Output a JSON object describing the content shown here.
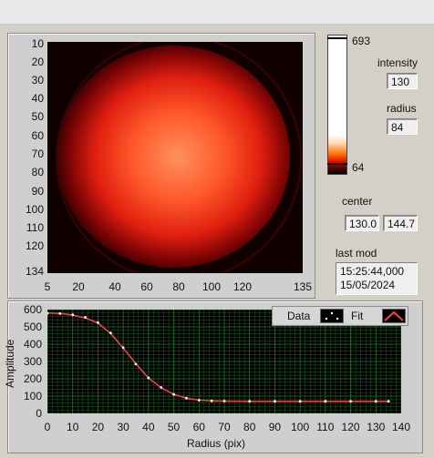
{
  "image": {
    "y_ticks": [
      "10",
      "20",
      "30",
      "40",
      "50",
      "60",
      "70",
      "80",
      "90",
      "100",
      "110",
      "120",
      "134"
    ],
    "x_ticks": [
      "5",
      "20",
      "40",
      "60",
      "80",
      "100",
      "120",
      "135"
    ]
  },
  "colorbar": {
    "max": "693",
    "min": "64"
  },
  "indicators": {
    "intensity_label": "intensity",
    "intensity_value": "130",
    "radius_label": "radius",
    "radius_value": "84",
    "center_label": "center",
    "center_x": "130.0",
    "center_y": "144.7",
    "lastmod_label": "last mod",
    "lastmod_time": "15:25:44,000",
    "lastmod_date": "15/05/2024"
  },
  "legend": {
    "data_label": "Data",
    "fit_label": "Fit"
  },
  "colors": {
    "data": "#ffffff",
    "fit": "#ff4040",
    "grid": "#1f7a2a",
    "plot_bg": "#000000"
  },
  "chart_data": {
    "type": "scatter",
    "xlabel": "Radius (pix)",
    "ylabel": "Amplitude",
    "xlim": [
      0,
      140
    ],
    "ylim": [
      0,
      600
    ],
    "x_ticks": [
      0,
      10,
      20,
      30,
      40,
      50,
      60,
      70,
      80,
      90,
      100,
      110,
      120,
      130,
      140
    ],
    "y_ticks": [
      0,
      100,
      200,
      300,
      400,
      500,
      600
    ],
    "series": [
      {
        "name": "Data",
        "x": [
          0,
          5,
          10,
          15,
          20,
          25,
          30,
          35,
          40,
          45,
          50,
          55,
          60,
          65,
          70,
          80,
          90,
          100,
          110,
          120,
          130,
          135
        ],
        "y": [
          578,
          577,
          570,
          555,
          525,
          465,
          380,
          285,
          205,
          150,
          110,
          88,
          76,
          72,
          71,
          70,
          70,
          70,
          70,
          70,
          70,
          70
        ]
      },
      {
        "name": "Fit",
        "x": [
          0,
          5,
          10,
          15,
          20,
          25,
          30,
          35,
          40,
          45,
          50,
          55,
          60,
          65,
          70,
          80,
          90,
          100,
          110,
          120,
          130,
          135
        ],
        "y": [
          580,
          578,
          568,
          552,
          522,
          462,
          378,
          287,
          205,
          148,
          110,
          88,
          77,
          73,
          71,
          70,
          70,
          70,
          70,
          70,
          70,
          70
        ]
      }
    ]
  }
}
